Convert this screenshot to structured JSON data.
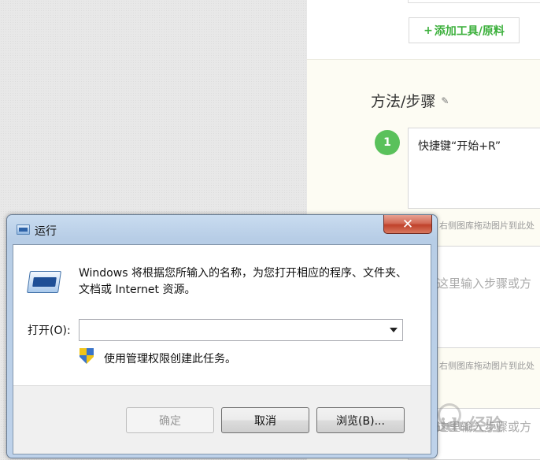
{
  "page": {
    "add_tool_plus": "+",
    "add_tool_label": "添加工具/原料",
    "section_title": "方法/步骤",
    "step_number": "1",
    "step_text": "快捷键“开始+R”",
    "image_hint": "右侧图库拖动图片到此处",
    "step_placeholder": "这里输入步骤或方",
    "watermark": "Baidu经验"
  },
  "dialog": {
    "title": "运行",
    "close_label": "✕",
    "description": "Windows 将根据您所输入的名称，为您打开相应的程序、文件夹、文档或 Internet 资源。",
    "open_label": "打开(O):",
    "open_value": "",
    "admin_text": "使用管理权限创建此任务。",
    "buttons": {
      "ok": "确定",
      "cancel": "取消",
      "browse": "浏览(B)..."
    }
  },
  "colors": {
    "accent_green": "#5ac15b",
    "close_red": "#c0412b",
    "title_blue": "#bed2ea"
  }
}
